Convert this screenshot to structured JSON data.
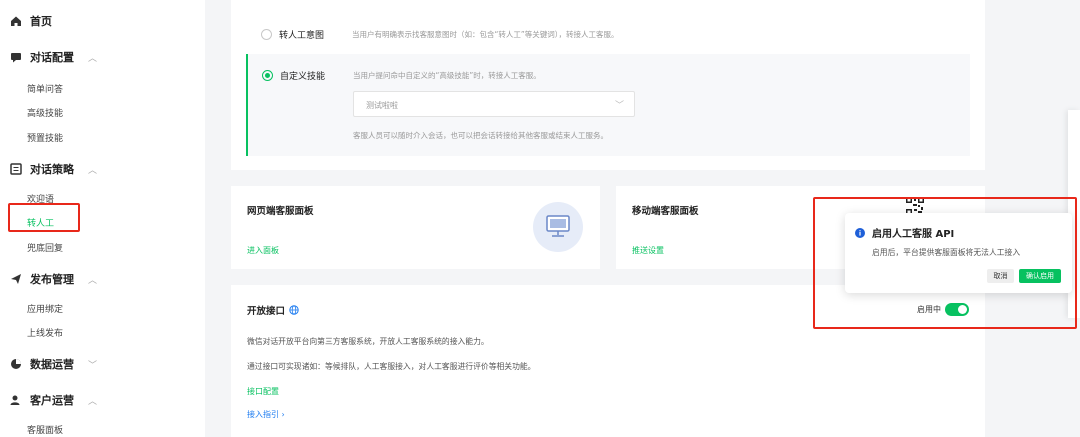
{
  "sidebar": {
    "home": "首页",
    "groups": [
      {
        "label": "对话配置",
        "items": [
          "简单问答",
          "高级技能",
          "预置技能"
        ]
      },
      {
        "label": "对话策略",
        "items": [
          "欢迎语",
          "转人工",
          "兜底回复"
        ]
      },
      {
        "label": "发布管理",
        "items": [
          "应用绑定",
          "上线发布"
        ]
      },
      {
        "label": "数据运营",
        "items": []
      },
      {
        "label": "客户运营",
        "items": [
          "客服面板"
        ]
      }
    ],
    "active_item": "转人工"
  },
  "transfer": {
    "intent_label": "转人工意图",
    "intent_desc": "当用户有明确表示找客服意图时（如：包含“转人工”等关键词），转接人工客服。",
    "skill_label": "自定义技能",
    "skill_desc": "当用户提问命中自定义的“高级技能”时，转接人工客服。",
    "skill_select_value": "测试啦啦",
    "note": "客服人员可以随时介入会话，也可以把会话转接给其他客服或结束人工服务。"
  },
  "web_panel": {
    "title": "网页端客服面板",
    "link": "进入面板"
  },
  "mobile_panel": {
    "title": "移动端客服面板",
    "link": "推送设置"
  },
  "api": {
    "title": "开放接口",
    "status": "启用中",
    "enabled": true,
    "desc1": "微信对话开放平台向第三方客服系统，开放人工客服系统的接入能力。",
    "desc2": "通过接口可实现诸如：等候排队，人工客服接入，对人工客服进行评价等相关功能。",
    "config_link": "接口配置",
    "guide_link": "接入指引 ›"
  },
  "popover": {
    "title": "启用人工客服 API",
    "body": "启用后，平台提供客服面板将无法人工接入",
    "cancel": "取消",
    "confirm": "确认启用"
  },
  "colors": {
    "accent": "#07c160",
    "link_blue": "#1e7cf0",
    "highlight_red": "#e8281a"
  }
}
